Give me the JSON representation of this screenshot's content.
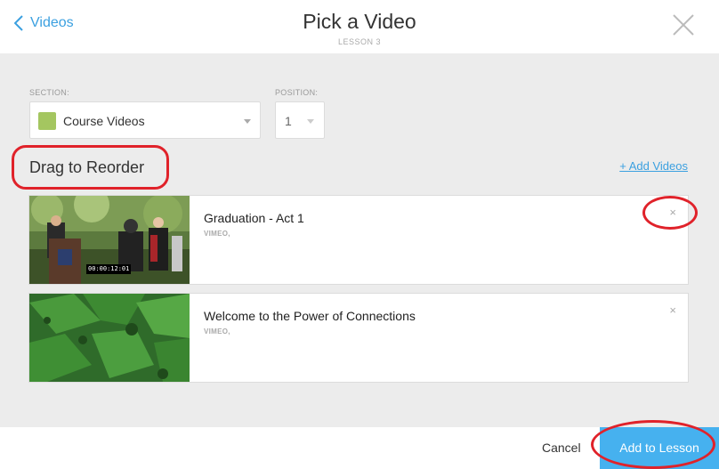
{
  "header": {
    "back_label": "Videos",
    "title": "Pick a Video",
    "subtitle": "LESSON 3"
  },
  "form": {
    "section_label": "SECTION:",
    "section_value": "Course Videos",
    "section_color": "#a4c660",
    "position_label": "POSITION:",
    "position_value": "1"
  },
  "list": {
    "heading": "Drag to Reorder",
    "add_link": "+ Add Videos",
    "items": [
      {
        "title": "Graduation - Act 1",
        "source": "VIMEO,",
        "timestamp": "00:00:12:01"
      },
      {
        "title": "Welcome to the Power of Connections",
        "source": "VIMEO,"
      }
    ]
  },
  "footer": {
    "cancel_label": "Cancel",
    "submit_label": "Add to Lesson"
  },
  "colors": {
    "accent": "#46b1ef",
    "link": "#3ba0e0",
    "highlight_ring": "#e0222a"
  }
}
